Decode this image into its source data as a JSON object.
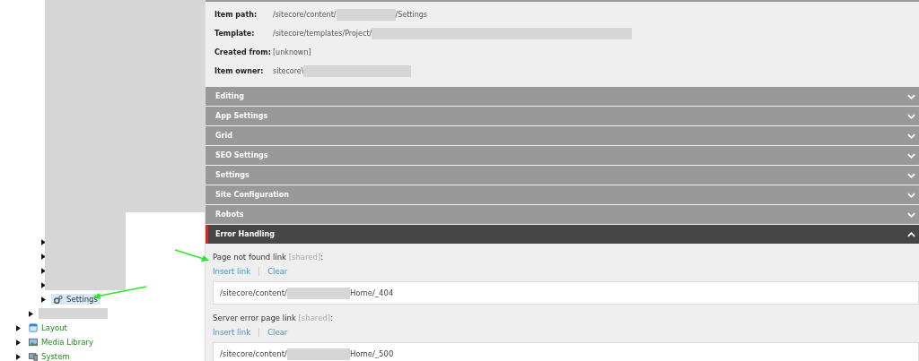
{
  "tree": [
    {
      "children": [
        {
          "children": [
            {
              "kind": "covered"
            },
            {
              "kind": "covered"
            },
            {
              "kind": "covered"
            },
            {
              "kind": "covered"
            },
            {
              "label": "Settings",
              "kind": "gears",
              "selected": true
            }
          ]
        },
        {
          "kind": "redacted"
        }
      ]
    },
    {
      "label": "Layout",
      "kind": "layout",
      "selected": false
    },
    {
      "label": "Media Library",
      "kind": "media",
      "selected": false
    },
    {
      "label": "System",
      "kind": "system",
      "selected": false
    }
  ],
  "info": [
    {
      "label": "Item path:",
      "value_parts": [
        {
          "kind": "text",
          "text": "/sitecore/content/"
        },
        {
          "kind": "redacted"
        },
        {
          "kind": "text",
          "text": "/Settings"
        }
      ]
    },
    {
      "label": "Template:",
      "value_parts": [
        {
          "kind": "text",
          "text": "/sitecore/templates/Project/"
        },
        {
          "kind": "redacted"
        }
      ]
    },
    {
      "label": "Created from:",
      "value_parts": [
        {
          "kind": "text",
          "text": "[unknown]"
        }
      ]
    },
    {
      "label": "Item owner:",
      "value_parts": [
        {
          "kind": "text",
          "text": "sitecore\\"
        },
        {
          "kind": "redacted"
        }
      ]
    }
  ],
  "sections": [
    {
      "title": "Editing",
      "expanded": false
    },
    {
      "title": "App Settings",
      "expanded": false
    },
    {
      "title": "Grid",
      "expanded": false
    },
    {
      "title": "SEO Settings",
      "expanded": false
    },
    {
      "title": "Settings",
      "expanded": false
    },
    {
      "title": "Site Configuration",
      "expanded": false
    },
    {
      "title": "Robots",
      "expanded": false
    },
    {
      "title": "Error Handling",
      "expanded": true
    }
  ],
  "fields": [
    {
      "label": "Page not found link",
      "tag": "[shared]",
      "suffix": ":",
      "actions": [
        "Insert link",
        "Clear"
      ],
      "value_parts": [
        {
          "kind": "text",
          "text": "/sitecore/content/"
        },
        {
          "kind": "redacted"
        },
        {
          "kind": "text",
          "text": "Home/_404"
        }
      ]
    },
    {
      "label": "Server error page link",
      "tag": "[shared]",
      "suffix": ":",
      "actions": [
        "Insert link",
        "Clear"
      ],
      "value_parts": [
        {
          "kind": "text",
          "text": "/sitecore/content/"
        },
        {
          "kind": "redacted"
        },
        {
          "kind": "text",
          "text": "Home/_500"
        }
      ]
    }
  ]
}
